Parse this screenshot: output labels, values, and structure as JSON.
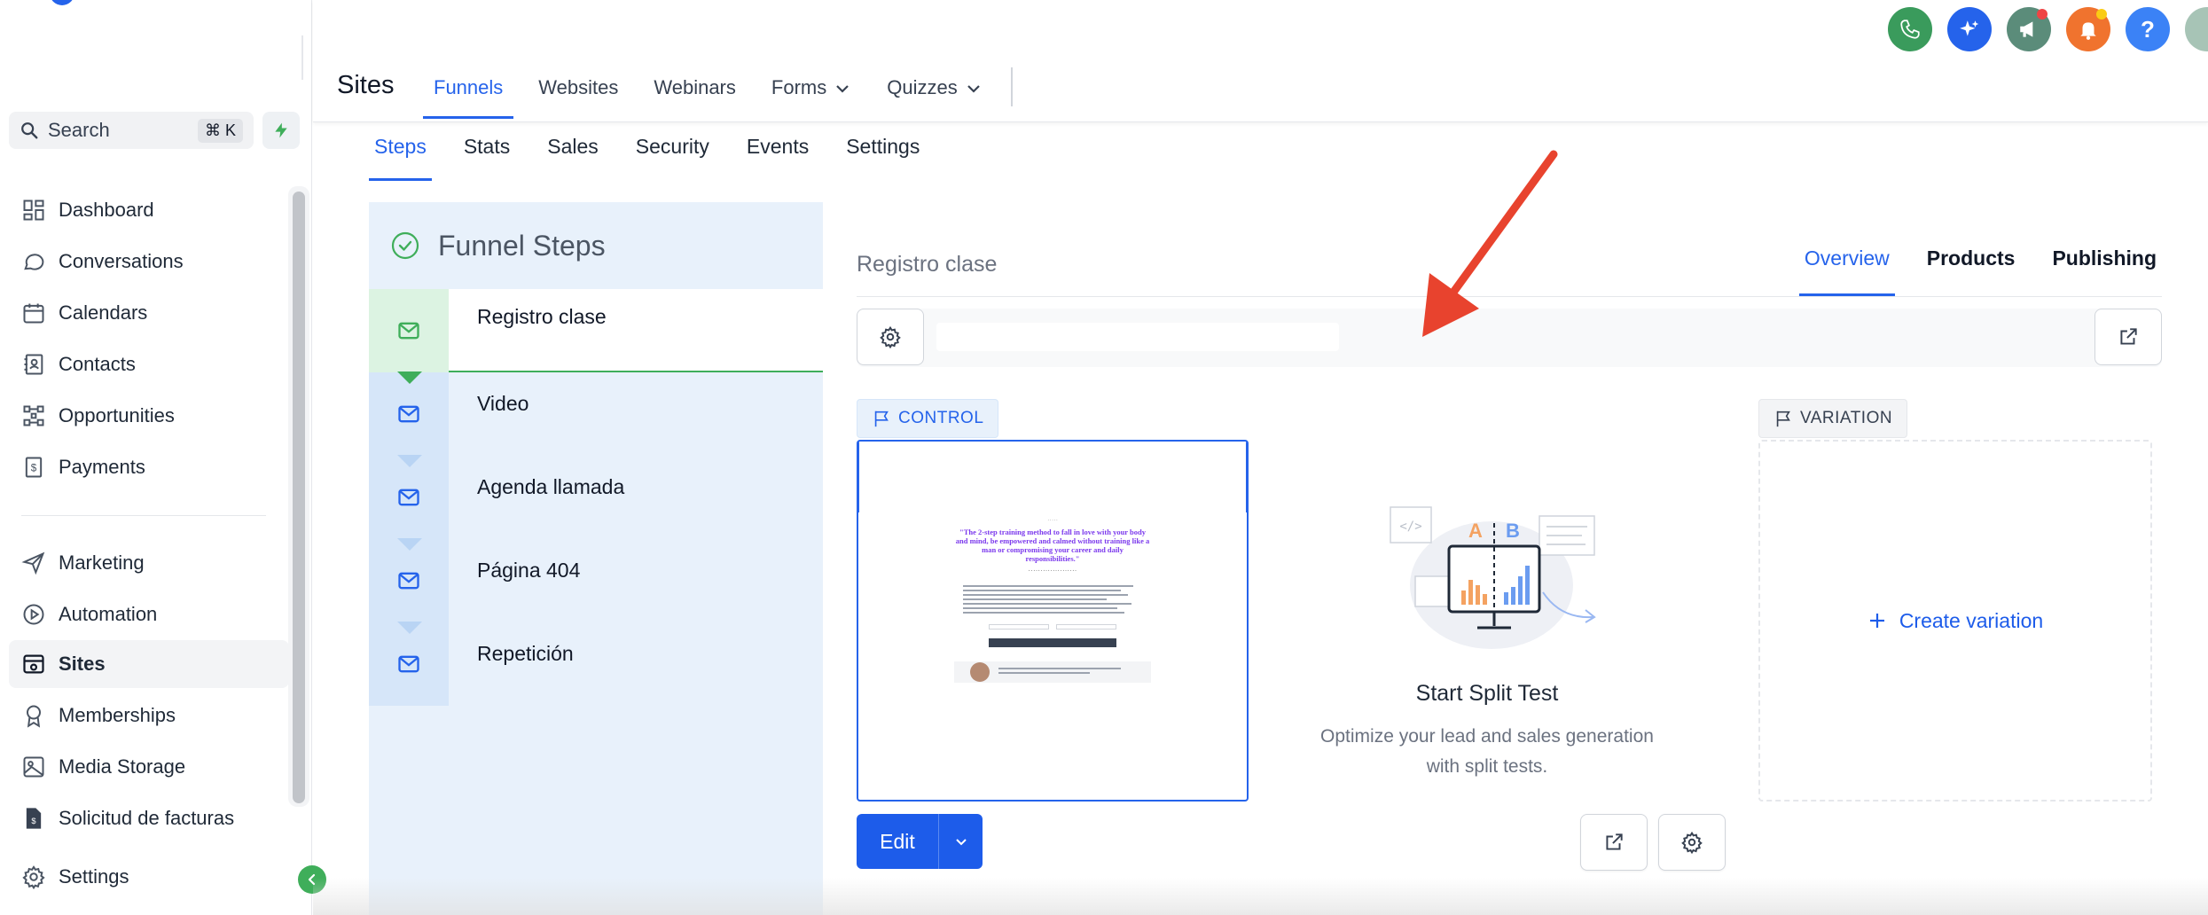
{
  "sidebar": {
    "search_label": "Search",
    "search_shortcut": "⌘ K",
    "items": [
      {
        "label": "Dashboard",
        "icon": "dashboard-icon"
      },
      {
        "label": "Conversations",
        "icon": "chat-icon"
      },
      {
        "label": "Calendars",
        "icon": "calendar-icon"
      },
      {
        "label": "Contacts",
        "icon": "contacts-icon"
      },
      {
        "label": "Opportunities",
        "icon": "opportunities-icon"
      },
      {
        "label": "Payments",
        "icon": "payments-icon"
      },
      {
        "label": "Marketing",
        "icon": "send-icon"
      },
      {
        "label": "Automation",
        "icon": "automation-icon"
      },
      {
        "label": "Sites",
        "icon": "sites-icon",
        "active": true
      },
      {
        "label": "Memberships",
        "icon": "badge-icon"
      },
      {
        "label": "Media Storage",
        "icon": "image-icon"
      },
      {
        "label": "Solicitud de facturas",
        "icon": "document-icon"
      },
      {
        "label": "Settings",
        "icon": "gear-icon"
      }
    ]
  },
  "header": {
    "title": "Sites",
    "tabs": [
      {
        "label": "Funnels",
        "active": true
      },
      {
        "label": "Websites"
      },
      {
        "label": "Webinars"
      },
      {
        "label": "Forms",
        "dropdown": true
      },
      {
        "label": "Quizzes",
        "dropdown": true
      }
    ],
    "icons": [
      {
        "name": "phone-icon",
        "color": "#3a9b5c"
      },
      {
        "name": "sparkle-icon",
        "color": "#2563eb"
      },
      {
        "name": "megaphone-icon",
        "color": "#5b8c7a",
        "badge": "#ef4444"
      },
      {
        "name": "bell-icon",
        "color": "#f0732e",
        "badge": "#facc15"
      },
      {
        "name": "help-icon",
        "color": "#3b82f6",
        "text": "?"
      }
    ]
  },
  "subtabs": [
    {
      "label": "Steps",
      "active": true
    },
    {
      "label": "Stats"
    },
    {
      "label": "Sales"
    },
    {
      "label": "Security"
    },
    {
      "label": "Events"
    },
    {
      "label": "Settings"
    }
  ],
  "funnel_steps": {
    "title": "Funnel Steps",
    "steps": [
      {
        "label": "Registro clase",
        "active": true
      },
      {
        "label": "Video"
      },
      {
        "label": "Agenda llamada"
      },
      {
        "label": "Página 404"
      },
      {
        "label": "Repetición"
      }
    ]
  },
  "detail": {
    "title": "Registro clase",
    "tabs": [
      {
        "label": "Overview",
        "active": true
      },
      {
        "label": "Products"
      },
      {
        "label": "Publishing"
      }
    ],
    "control_label": "CONTROL",
    "variation_label": "VARIATION",
    "edit_label": "Edit",
    "split_title": "Start Split Test",
    "split_desc": "Optimize your lead and sales generation with split tests.",
    "create_variation": "Create variation",
    "preview": {
      "headline": "\"The 2-step training method to fall in love with your body and mind, be empowered and calmed without training like a man or compromising your career and daily responsibilities.\""
    }
  },
  "colors": {
    "accent": "#2563eb",
    "success": "#3fae5a",
    "steps_bg": "#e8f1fb",
    "annotation": "#e8432e"
  }
}
